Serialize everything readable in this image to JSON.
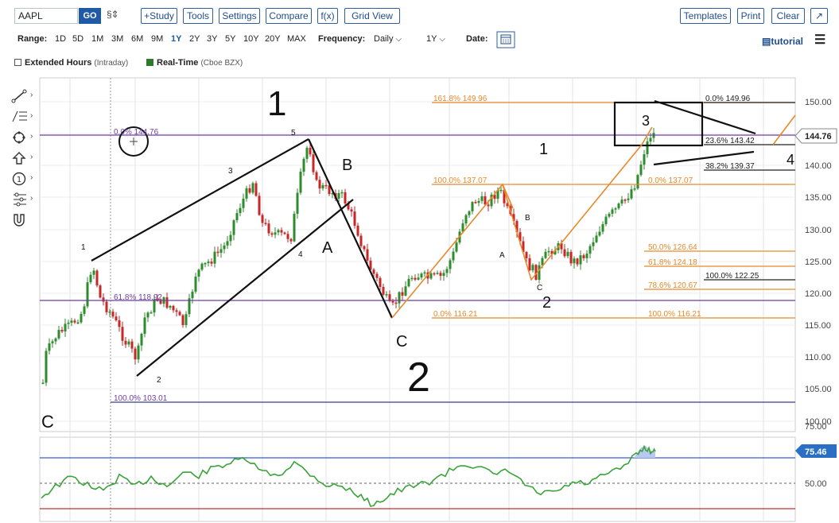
{
  "toolbar": {
    "symbol": "AAPL",
    "go_label": "GO",
    "compare_icon_glyph": "§⇕",
    "buttons_left": [
      "+Study",
      "Tools",
      "Settings",
      "Compare",
      "f(x)",
      "Grid View"
    ],
    "buttons_right": [
      "Templates",
      "Print",
      "Clear"
    ],
    "popout_glyph": "↗"
  },
  "range": {
    "label": "Range:",
    "options": [
      "1D",
      "5D",
      "1M",
      "3M",
      "6M",
      "9M",
      "1Y",
      "2Y",
      "3Y",
      "5Y",
      "10Y",
      "20Y",
      "MAX"
    ],
    "selected": "1Y",
    "frequency_label": "Frequency:",
    "frequency_value": "Daily",
    "period_value": "1Y",
    "date_label": "Date:",
    "tutorial_label": "tutorial"
  },
  "options": {
    "extended_label": "Extended Hours",
    "extended_note": "(Intraday)",
    "realtime_label": "Real-Time",
    "realtime_note": "(Cboe BZX)"
  },
  "colors": {
    "accent": "#1f5aa6",
    "fib_orange": "#e8892b",
    "fib_purple": "#6b3fa0",
    "rsi_green": "#3aa33a",
    "rsi_blue": "#3b5bdb",
    "price_tag": "#2a6fc4"
  },
  "price_axis": [
    "150.00",
    "145.00",
    "140.00",
    "135.00",
    "130.00",
    "125.00",
    "120.00",
    "115.00",
    "110.00",
    "105.00",
    "100.00"
  ],
  "current_price": "144.76",
  "rsi_axis": [
    "75.00",
    "50.00"
  ],
  "rsi_value": "75.46",
  "fib_labels": {
    "purple_top": "0.0% 144.76",
    "purple_mid": "61.8% 118.92",
    "purple_bottom": "100.0% 103.01",
    "orange_161": "161.8% 149.96",
    "orange_100": "100.0% 137.07",
    "orange_0": "0.0% 116.21",
    "right_0": "0.0% 149.96",
    "right_236": "23.6% 143.42",
    "right_382": "38.2% 139.37",
    "right_0b": "0.0% 137.07",
    "right_50": "50.0% 126.64",
    "right_618": "61.8% 124.18",
    "right_100a": "100.0% 122.25",
    "right_786": "78.6% 120.67",
    "right_100b": "100.0% 116.21"
  },
  "wave_labels": {
    "big1": "1",
    "big2": "2",
    "c_left": "C",
    "A": "A",
    "B": "B",
    "C": "C",
    "w1": "1",
    "w2": "2",
    "w3": "3",
    "w4": "4",
    "w5": "5",
    "r1": "1",
    "r2": "2",
    "r3": "3",
    "r4": "4",
    "sa": "A",
    "sb": "B",
    "sc": "C"
  }
}
